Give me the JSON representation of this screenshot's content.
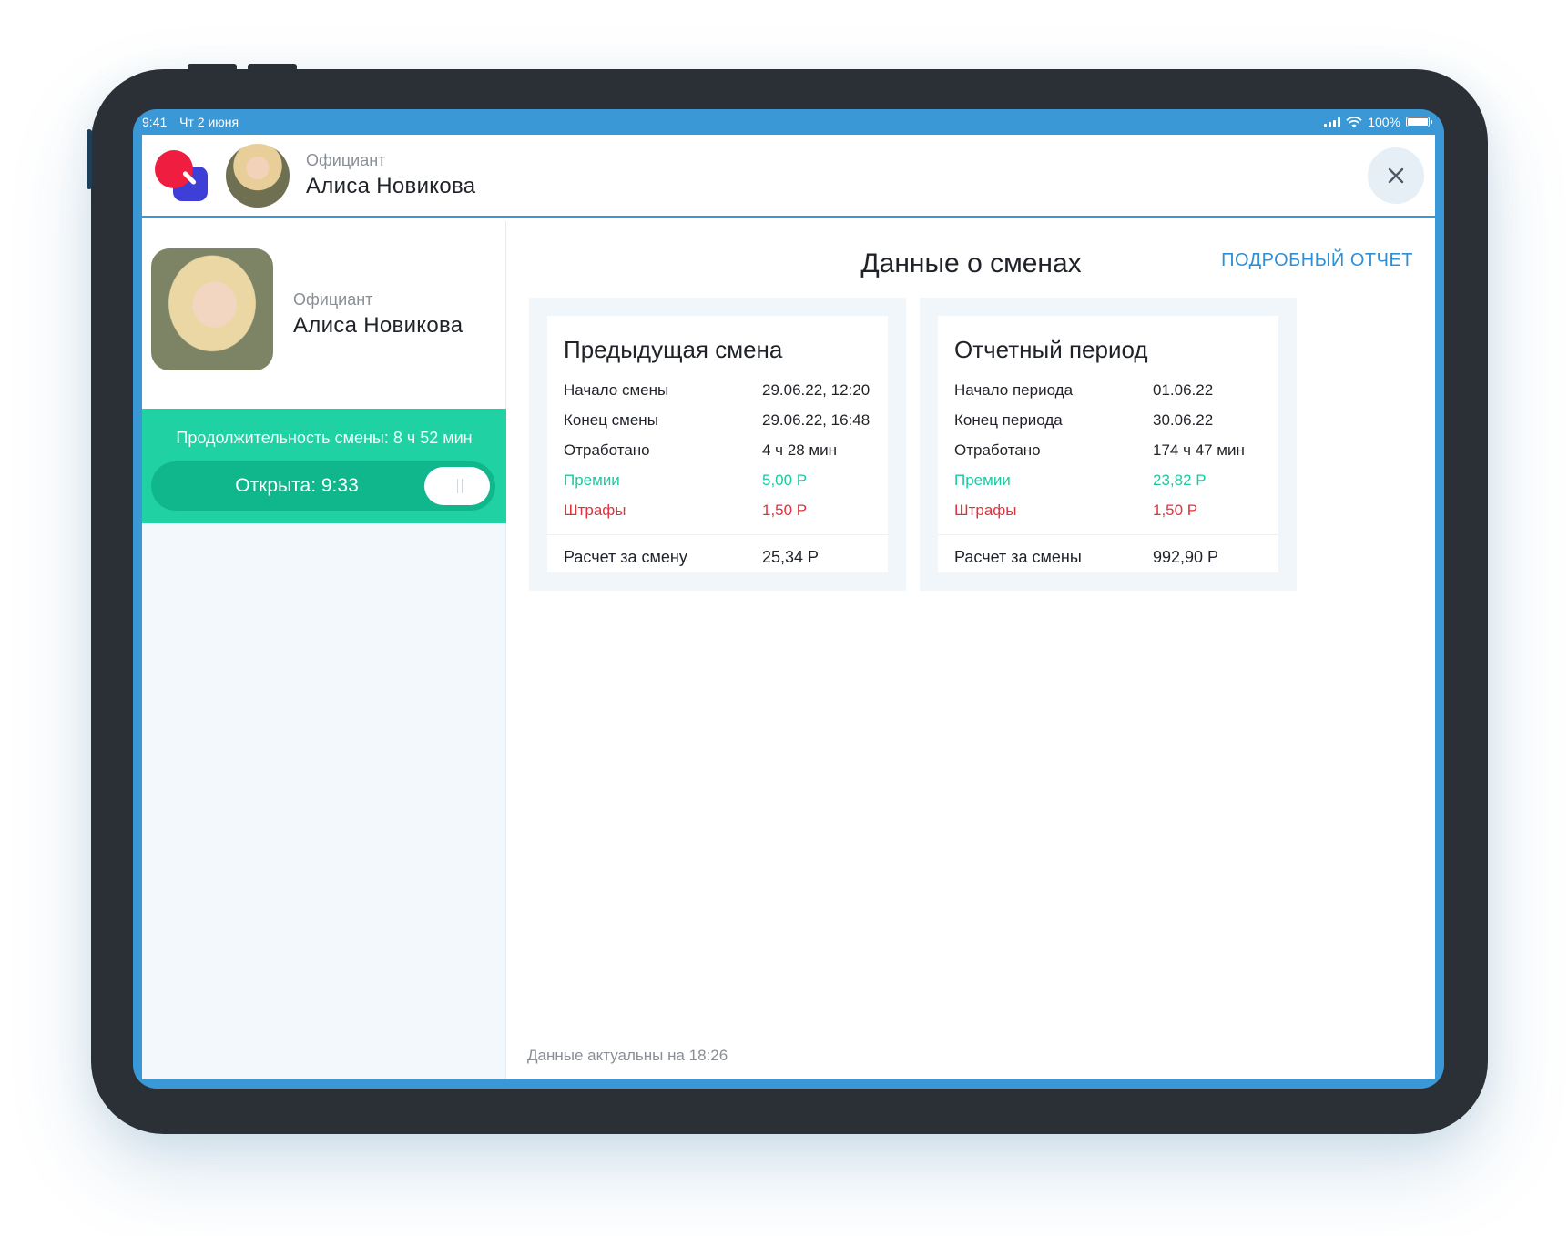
{
  "status_bar": {
    "time": "9:41",
    "date": "Чт 2 июня",
    "battery": "100%"
  },
  "header": {
    "role": "Официант",
    "name": "Алиса Новикова"
  },
  "sidebar": {
    "role": "Официант",
    "name": "Алиса Новикова",
    "shift_duration": "Продолжительность смены: 8 ч 52 мин",
    "shift_status": "Открыта: 9:33"
  },
  "main": {
    "title": "Данные о сменах",
    "report_link": "ПОДРОБНЫЙ ОТЧЕТ",
    "previous_shift": {
      "title": "Предыдущая смена",
      "rows": [
        {
          "label": "Начало смены",
          "value": "29.06.22, 12:20"
        },
        {
          "label": "Конец смены",
          "value": "29.06.22, 16:48"
        },
        {
          "label": "Отработано",
          "value": "4 ч 28 мин"
        },
        {
          "label": "Премии",
          "value": "5,00 Р"
        },
        {
          "label": "Штрафы",
          "value": "1,50 Р"
        }
      ],
      "total_label": "Расчет за смену",
      "total_value": "25,34 Р"
    },
    "report_period": {
      "title": "Отчетный период",
      "rows": [
        {
          "label": "Начало периода",
          "value": "01.06.22"
        },
        {
          "label": "Конец периода",
          "value": "30.06.22"
        },
        {
          "label": "Отработано",
          "value": "174 ч 47 мин"
        },
        {
          "label": "Премии",
          "value": "23,82 Р"
        },
        {
          "label": "Штрафы",
          "value": "1,50 Р"
        }
      ],
      "total_label": "Расчет за смены",
      "total_value": "992,90 Р"
    },
    "footnote": "Данные актуальны на 18:26"
  },
  "colors": {
    "accent_blue": "#3a98d6",
    "shift_green": "#1fd1a3",
    "bonus": "#1ec9a0",
    "fine": "#e0323c",
    "link": "#2f8fd6"
  }
}
